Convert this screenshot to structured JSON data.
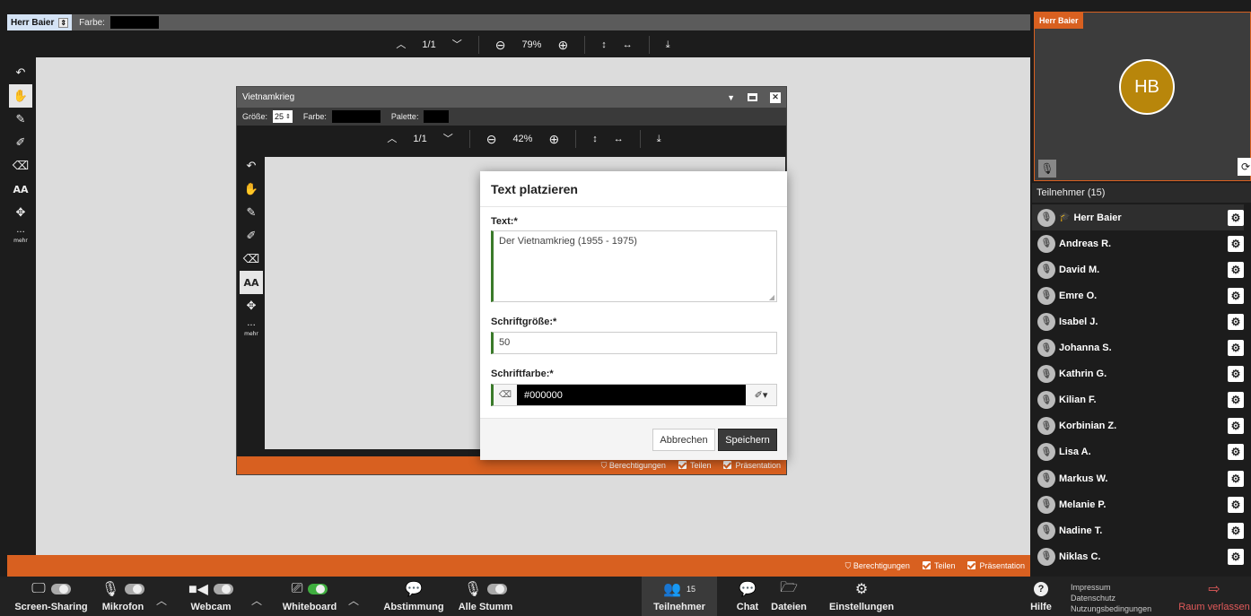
{
  "main": {
    "user_select": "Herr Baier",
    "color_label": "Farbe:",
    "nav": {
      "page": "1/1",
      "zoom": "79%"
    },
    "tools": {
      "more_label": "mehr"
    },
    "status": {
      "permissions": "Berechtigungen",
      "share": "Teilen",
      "presentation": "Präsentation"
    }
  },
  "window": {
    "title": "Vietnamkrieg",
    "size_label": "Größe:",
    "size_value": "25",
    "color_label": "Farbe:",
    "palette_label": "Palette:",
    "nav": {
      "page": "1/1",
      "zoom": "42%"
    },
    "more_label": "mehr",
    "status": {
      "permissions": "Berechtigungen",
      "share": "Teilen",
      "presentation": "Präsentation"
    }
  },
  "dialog": {
    "title": "Text platzieren",
    "text_label": "Text:*",
    "text_value": "Der Vietnamkrieg (1955 - 1975)",
    "size_label": "Schriftgröße:*",
    "size_value": "50",
    "color_label": "Schriftfarbe:*",
    "color_value": "#000000",
    "cancel": "Abbrechen",
    "save": "Speichern"
  },
  "video": {
    "tile_name": "Herr Baier",
    "initials": "HB",
    "avatar_color": "#b8860b"
  },
  "participants": {
    "header": "Teilnehmer (15)",
    "list": [
      "Herr Baier",
      "Andreas R.",
      "David M.",
      "Emre O.",
      "Isabel J.",
      "Johanna S.",
      "Kathrin G.",
      "Kilian F.",
      "Korbinian Z.",
      "Lisa A.",
      "Markus W.",
      "Melanie P.",
      "Nadine T.",
      "Niklas C."
    ]
  },
  "bottom": {
    "screen": "Screen-Sharing",
    "mic": "Mikrofon",
    "webcam": "Webcam",
    "whiteboard": "Whiteboard",
    "poll": "Abstimmung",
    "mute_all": "Alle Stumm",
    "participants": "Teilnehmer",
    "participants_count": "15",
    "chat": "Chat",
    "files": "Dateien",
    "settings": "Einstellungen",
    "help": "Hilfe",
    "impressum": "Impressum",
    "privacy": "Datenschutz",
    "terms": "Nutzungsbedingungen",
    "leave": "Raum verlassen"
  },
  "colors": {
    "accent": "#d86020",
    "leave": "#e25a5a",
    "green": "#3fae3f"
  }
}
